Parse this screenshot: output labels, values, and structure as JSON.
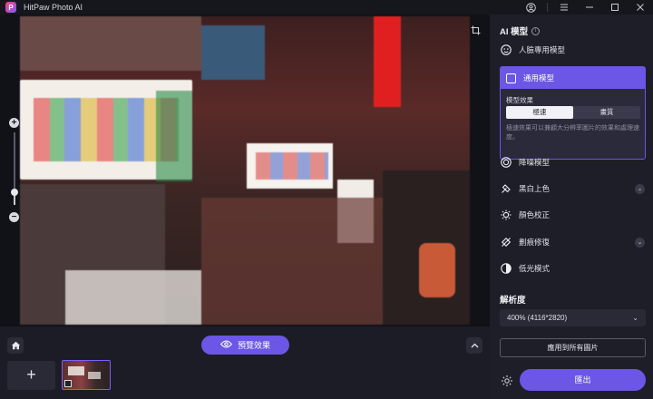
{
  "app": {
    "title": "HitPaw Photo AI",
    "logo_letter": "P",
    "accent_color": "#6b56e6"
  },
  "window_controls": {
    "icons": [
      "account-icon",
      "menu-icon",
      "minimize-icon",
      "maximize-icon",
      "close-icon"
    ]
  },
  "canvas": {
    "tools": {
      "crop_icon": "crop-icon"
    }
  },
  "zoom": {
    "plus": "+",
    "minus": "−",
    "level_fraction": 0.18
  },
  "bottom_bar": {
    "preview_label": "預覽效果",
    "add_label": "+"
  },
  "panel": {
    "ai_model_title": "AI 模型",
    "models": [
      {
        "label": "人臉專用模型",
        "icon": "face-icon"
      },
      {
        "label": "通用模型",
        "icon": "image-icon",
        "selected": true
      },
      {
        "label": "降噪模型",
        "icon": "denoise-icon"
      },
      {
        "label": "黑白上色",
        "icon": "colorize-icon",
        "expandable": true
      },
      {
        "label": "顏色校正",
        "icon": "color-correct-icon"
      },
      {
        "label": "劃痕修復",
        "icon": "scratch-repair-icon",
        "expandable": true
      },
      {
        "label": "低光模式",
        "icon": "low-light-icon"
      }
    ],
    "general_model_card": {
      "effect_label": "模型效果",
      "options": [
        "極速",
        "畫質"
      ],
      "selected_option": "極速",
      "description": "極速效果可以兼顧大分辨率圖片的效果和處理速度。"
    },
    "resolution_title": "解析度",
    "resolution_value": "400% (4116*2820)",
    "apply_all_label": "應用到所有圖片",
    "export_label": "匯出"
  }
}
